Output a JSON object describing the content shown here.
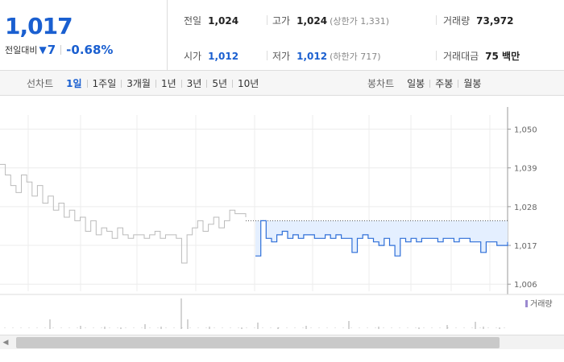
{
  "price": {
    "current": "1,017",
    "diff_label": "전일대비",
    "diff_arrow": "▼",
    "diff_value": "7",
    "diff_pct": "-0.68%"
  },
  "stats": {
    "prev_close": {
      "label": "전일",
      "value": "1,024"
    },
    "high": {
      "label": "고가",
      "value": "1,024",
      "sub": "(상한가 1,331)"
    },
    "volume": {
      "label": "거래량",
      "value": "73,972"
    },
    "open": {
      "label": "시가",
      "value": "1,012"
    },
    "low": {
      "label": "저가",
      "value": "1,012",
      "sub": "(하한가 717)"
    },
    "amount": {
      "label": "거래대금",
      "value": "75 백만"
    }
  },
  "toolbar": {
    "line_label": "선차트",
    "line_items": [
      "1일",
      "1주일",
      "3개월",
      "1년",
      "3년",
      "5년",
      "10년"
    ],
    "active_line_item": "1일",
    "candle_label": "봉차트",
    "candle_items": [
      "일봉",
      "주봉",
      "월봉"
    ]
  },
  "chart_data": {
    "type": "line",
    "y_ticks": [
      "1,050",
      "1,039",
      "1,028",
      "1,017",
      "1,006"
    ],
    "y_tick_values": [
      1050,
      1039,
      1028,
      1017,
      1006
    ],
    "ylim": [
      1004,
      1054
    ],
    "prev_close": 1024,
    "volume_label": "거래량",
    "series": [
      {
        "values": [
          1040,
          1037,
          1034,
          1032,
          1037,
          1035,
          1031,
          1034,
          1029,
          1031,
          1027,
          1029,
          1025,
          1027,
          1024,
          1025,
          1021,
          1024,
          1020,
          1022,
          1021,
          1019,
          1022,
          1020,
          1019,
          1020,
          1020,
          1019,
          1020,
          1021,
          1019,
          1020,
          1020,
          1019,
          1012,
          1020,
          1022,
          1024,
          1021,
          1023,
          1025,
          1022,
          1024,
          1027,
          1026,
          1026,
          1025
        ],
        "style": "prev-day"
      },
      {
        "values": [
          1014,
          1024,
          1019,
          1018,
          1020,
          1021,
          1019,
          1020,
          1019,
          1020,
          1020,
          1019,
          1019,
          1020,
          1019,
          1020,
          1019,
          1019,
          1015,
          1019,
          1020,
          1019,
          1018,
          1017,
          1019,
          1017,
          1014,
          1019,
          1018,
          1019,
          1018,
          1019,
          1019,
          1019,
          1018,
          1019,
          1019,
          1018,
          1019,
          1019,
          1018,
          1018,
          1015,
          1018,
          1018,
          1017,
          1017,
          1018
        ],
        "style": "today"
      }
    ]
  }
}
